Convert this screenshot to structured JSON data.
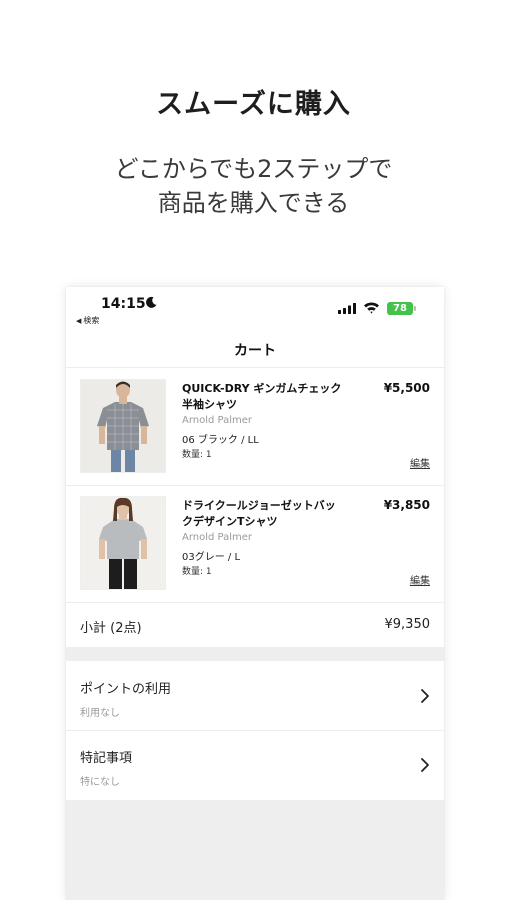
{
  "promo": {
    "title": "スムーズに購入",
    "subtitle_line1": "どこからでも2ステップで",
    "subtitle_line2": "商品を購入できる"
  },
  "status_bar": {
    "time": "14:15",
    "back_label": "検索",
    "battery": "78"
  },
  "nav": {
    "title": "カート"
  },
  "cart": {
    "items": [
      {
        "name_line1": "QUICK-DRY ギンガムチェック",
        "name_line2": "半袖シャツ",
        "brand": "Arnold Palmer",
        "variant": "06 ブラック / LL",
        "quantity": "数量: 1",
        "price": "¥5,500",
        "edit_label": "編集"
      },
      {
        "name_line1": "ドライクールジョーゼットバッ",
        "name_line2": "クデザインTシャツ",
        "brand": "Arnold Palmer",
        "variant": "03グレー / L",
        "quantity": "数量: 1",
        "price": "¥3,850",
        "edit_label": "編集"
      }
    ],
    "subtotal_label": "小計 (2点)",
    "subtotal_value": "¥9,350"
  },
  "options": {
    "points": {
      "label": "ポイントの利用",
      "value": "利用なし"
    },
    "notes": {
      "label": "特記事項",
      "value": "特になし"
    }
  },
  "colors": {
    "battery": "#44c24a",
    "band": "#eeeeee",
    "divider": "#ececec"
  }
}
